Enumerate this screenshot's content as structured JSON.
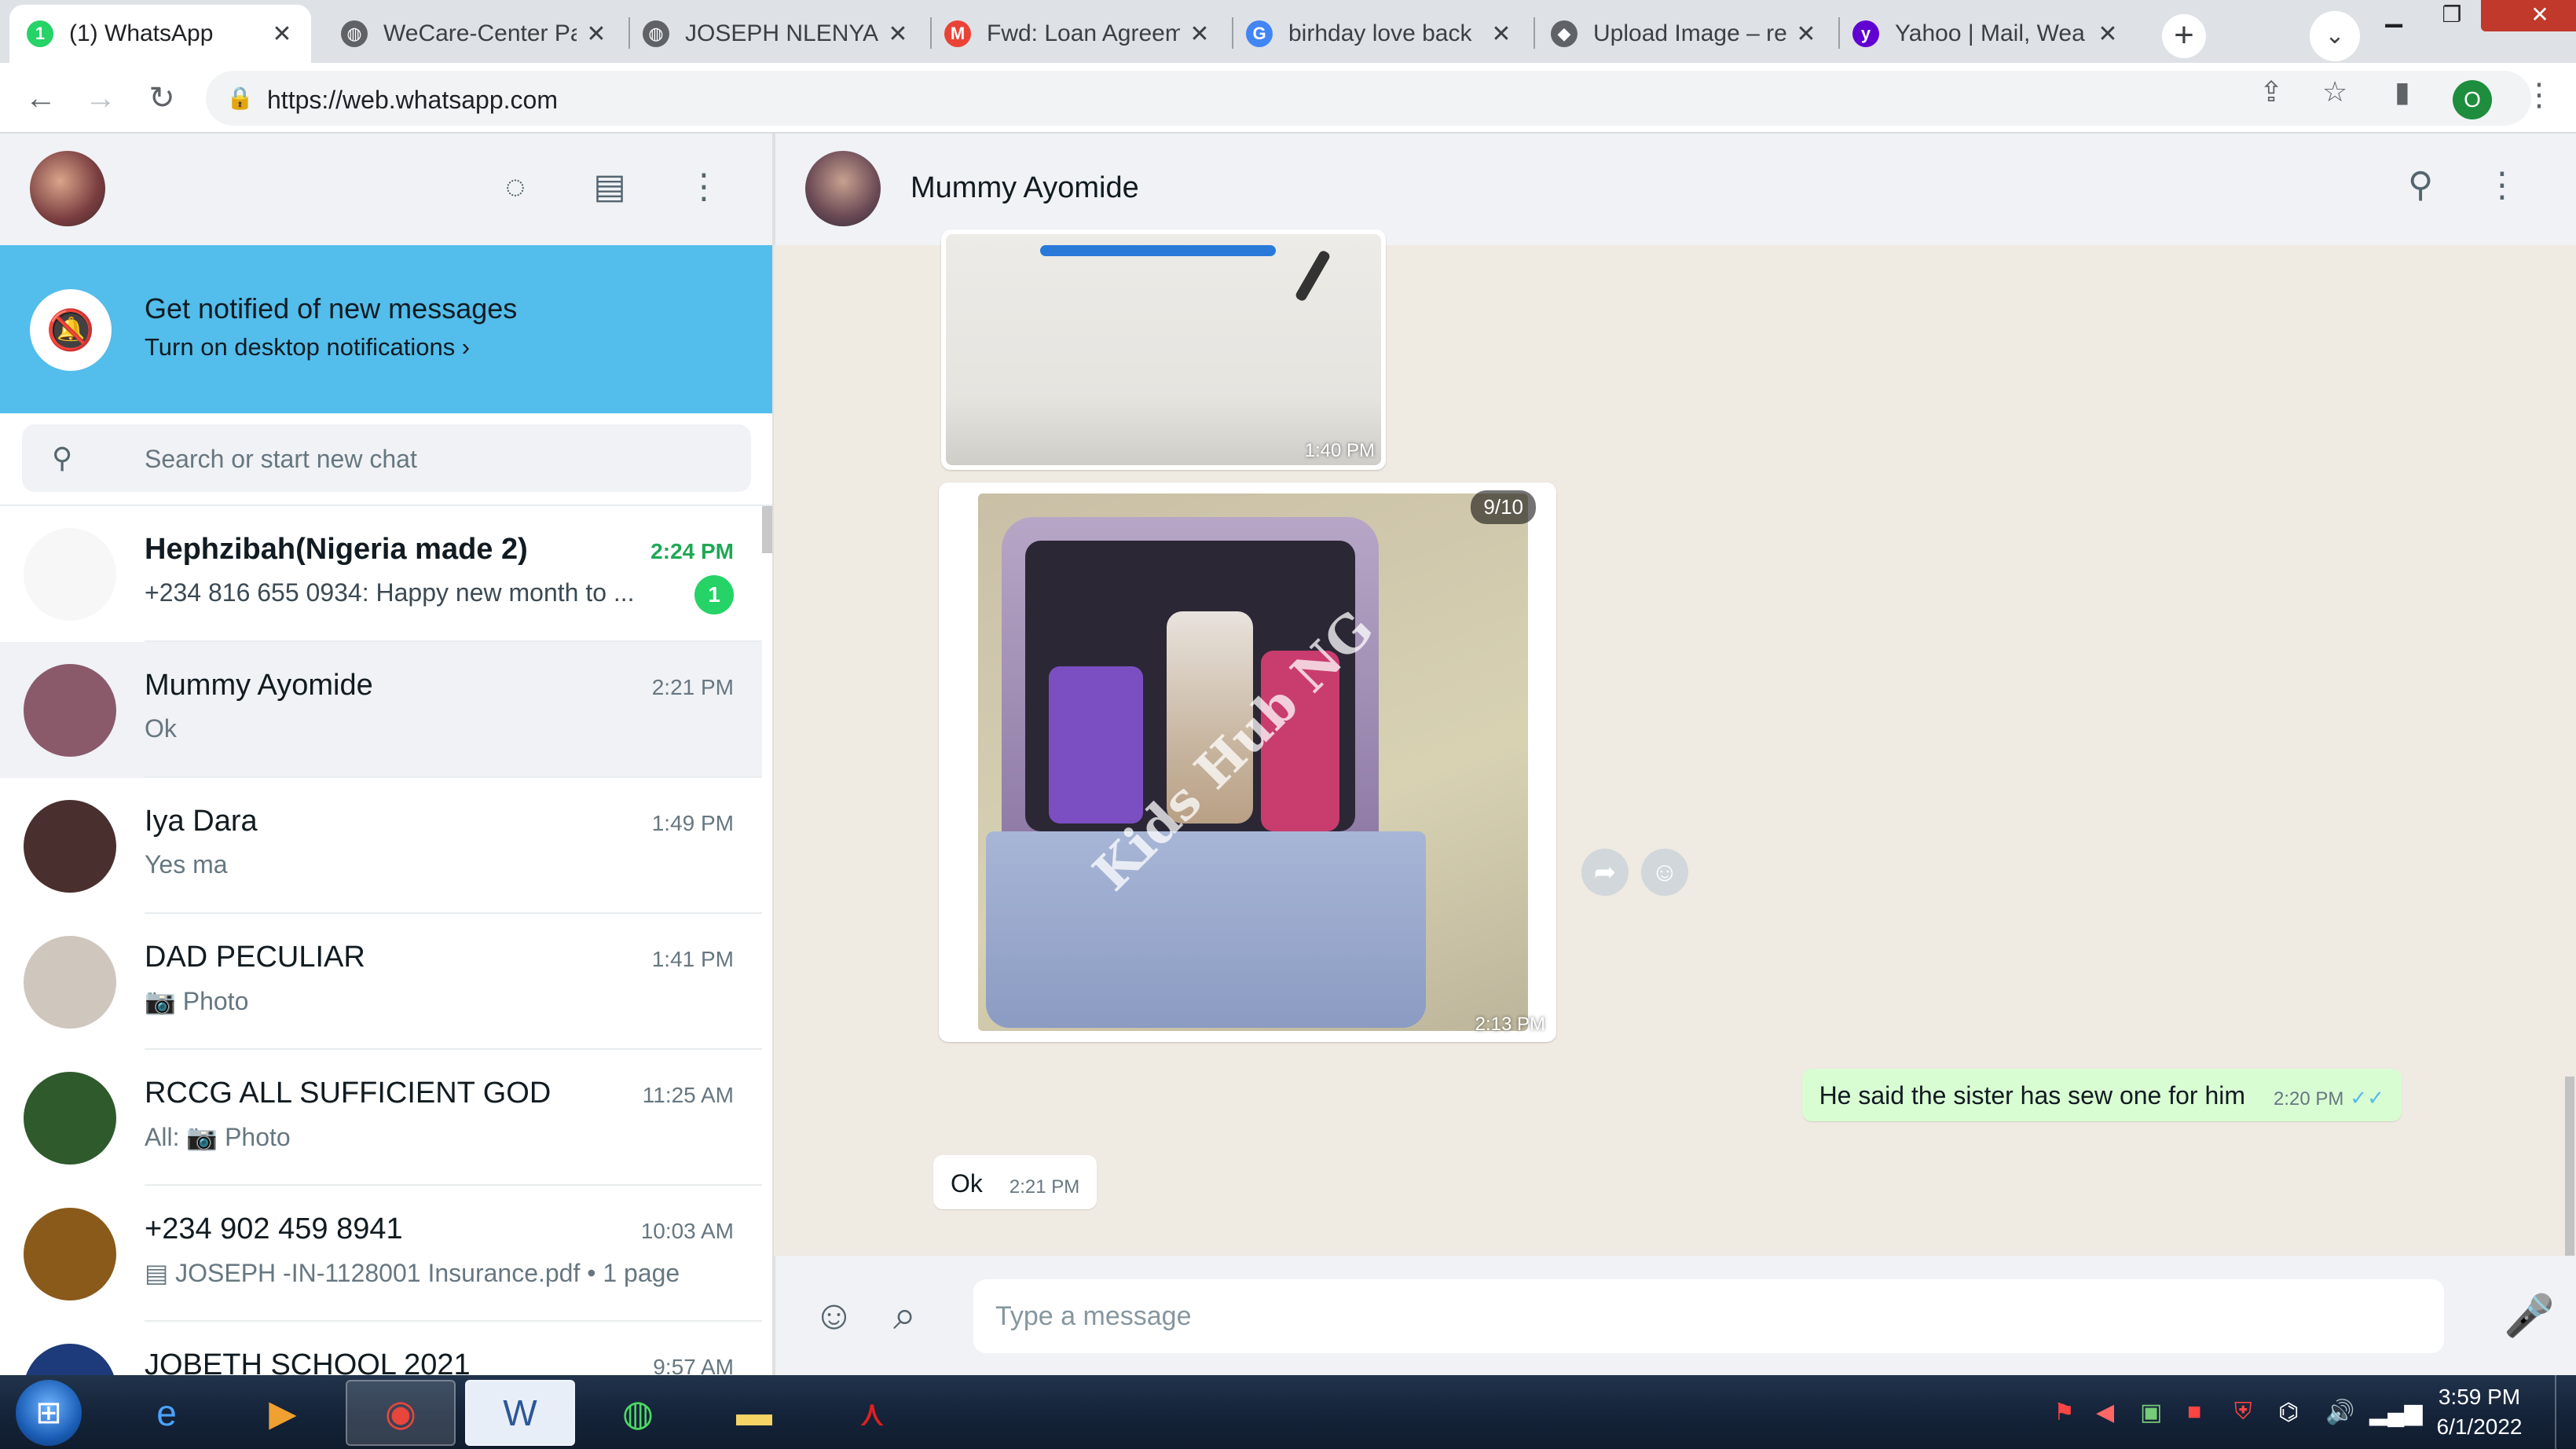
{
  "browser": {
    "tabs": [
      {
        "title": "(1) WhatsApp",
        "favicon": "whatsapp-icon",
        "color": "#25d366",
        "glyph": "1",
        "active": true
      },
      {
        "title": "WeCare-Center Pa",
        "favicon": "globe-icon",
        "color": "#5f6368",
        "glyph": "◍",
        "active": false
      },
      {
        "title": "JOSEPH NLENYA.p",
        "favicon": "globe-icon",
        "color": "#5f6368",
        "glyph": "◍",
        "active": false
      },
      {
        "title": "Fwd: Loan Agreem",
        "favicon": "gmail-icon",
        "color": "#ea4335",
        "glyph": "M",
        "active": false
      },
      {
        "title": "birhday love back",
        "favicon": "google-icon",
        "color": "#4285f4",
        "glyph": "G",
        "active": false
      },
      {
        "title": "Upload Image – re",
        "favicon": "upload-site-icon",
        "color": "#5f6368",
        "glyph": "◆",
        "active": false
      },
      {
        "title": "Yahoo | Mail, Wea",
        "favicon": "yahoo-icon",
        "color": "#6001d2",
        "glyph": "y",
        "active": false
      }
    ],
    "url": "https://web.whatsapp.com",
    "profile_initial": "O"
  },
  "whatsapp": {
    "notification": {
      "title": "Get notified of new messages",
      "subtitle": "Turn on desktop notifications ›"
    },
    "search": {
      "placeholder": "Search or start new chat"
    },
    "chats": [
      {
        "name": "Hephzibah(Nigeria made 2)",
        "time": "2:24 PM",
        "preview": "+234 816 655 0934: Happy new month to ...",
        "unread": "1",
        "bold": true,
        "avatar": "#f7f7f7"
      },
      {
        "name": "Mummy Ayomide",
        "time": "2:21 PM",
        "preview": "Ok",
        "selected": true,
        "avatar": "#8a5a6a"
      },
      {
        "name": "Iya Dara",
        "time": "1:49 PM",
        "preview": "Yes ma",
        "avatar": "#4a2f2f"
      },
      {
        "name": "DAD PECULIAR",
        "time": "1:41 PM",
        "preview": "📷 Photo",
        "avatar": "#cfc6bd"
      },
      {
        "name": "RCCG ALL SUFFICIENT GOD",
        "time": "11:25 AM",
        "preview": "All: 📷 Photo",
        "avatar": "#2e5a2c"
      },
      {
        "name": "+234 902 459 8941",
        "time": "10:03 AM",
        "preview": "▤ JOSEPH -IN-1128001 Insurance.pdf • 1 page",
        "avatar": "#8a5a1a"
      },
      {
        "name": "JOBETH SCHOOL 2021",
        "time": "9:57 AM",
        "preview": "",
        "avatar": "#1d3a7a"
      }
    ],
    "conversation": {
      "contact_name": "Mummy Ayomide",
      "image1_time": "1:40 PM",
      "image2_counter": "9/10",
      "image2_watermark": "Kids Hub NG",
      "image2_time": "2:13 PM",
      "outgoing_text": "He said the sister has sew one for him",
      "outgoing_time": "2:20 PM",
      "incoming_text": "Ok",
      "incoming_time": "2:21 PM"
    },
    "composer": {
      "placeholder": "Type a message"
    }
  },
  "taskbar": {
    "time": "3:59 PM",
    "date": "6/1/2022"
  }
}
